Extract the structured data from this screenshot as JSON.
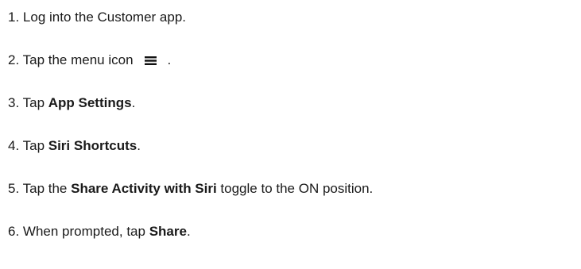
{
  "steps": [
    {
      "number": "1.",
      "text": "Log into the Customer app."
    },
    {
      "number": "2.",
      "before": "Tap the menu icon",
      "icon": "hamburger-menu-icon",
      "after": "."
    },
    {
      "number": "3.",
      "before": "Tap ",
      "bold": "App Settings",
      "after": "."
    },
    {
      "number": "4.",
      "before": "Tap ",
      "bold": "Siri Shortcuts",
      "after": "."
    },
    {
      "number": "5.",
      "before": "Tap the ",
      "bold": "Share Activity with Siri",
      "after": " toggle to the ON position."
    },
    {
      "number": "6.",
      "before": "When prompted, tap ",
      "bold": "Share",
      "after": "."
    }
  ]
}
